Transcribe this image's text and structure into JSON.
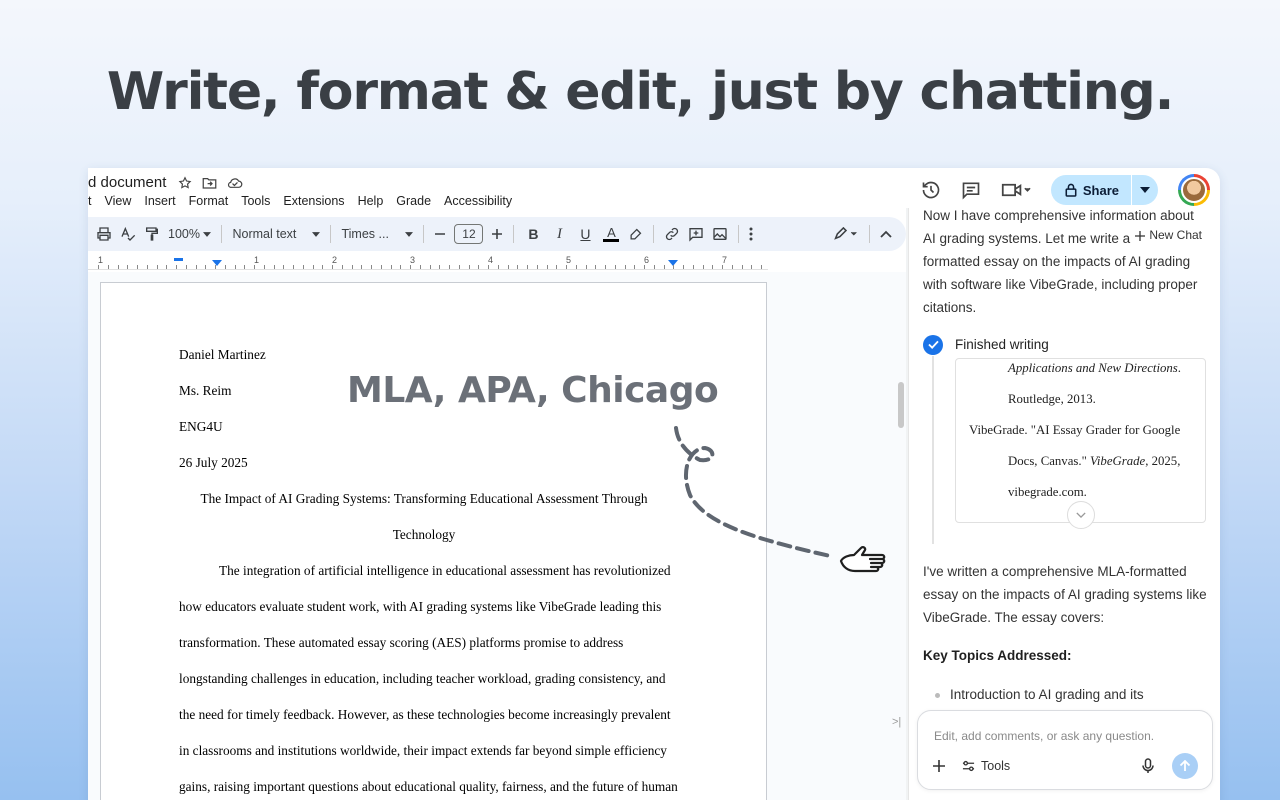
{
  "headline": "Write, format & edit, just by chatting.",
  "overlay_label": "MLA, APA, Chicago",
  "doc": {
    "title": "d document",
    "menu": [
      "t",
      "View",
      "Insert",
      "Format",
      "Tools",
      "Extensions",
      "Help",
      "Grade",
      "Accessibility"
    ],
    "share_label": "Share",
    "toolbar": {
      "zoom": "100%",
      "style": "Normal text",
      "font": "Times ...",
      "font_size": "12"
    },
    "ruler_numbers": [
      "1",
      "1",
      "2",
      "3",
      "4",
      "5",
      "6",
      "7"
    ],
    "lines": [
      "Daniel Martinez",
      "Ms. Reim",
      "ENG4U",
      "26 July 2025",
      "The Impact of AI Grading Systems: Transforming Educational Assessment Through",
      "Technology",
      "The integration of artificial intelligence in educational assessment has revolutionized",
      "how educators evaluate student work, with AI grading systems like VibeGrade leading this",
      "transformation. These automated essay scoring (AES) platforms promise to address",
      "longstanding challenges in education, including teacher workload, grading consistency, and",
      "the need for timely feedback. However, as these technologies become increasingly prevalent",
      "in classrooms and institutions worldwide, their impact extends far beyond simple efficiency",
      "gains, raising important questions about educational quality, fairness, and the future of human"
    ]
  },
  "chat": {
    "new_chat": "New Chat",
    "intro": "Now I have comprehensive information about AI grading systems. Let me write an MLA-formatted essay on the impacts of AI grading with software like VibeGrade, including proper citations.",
    "finished": "Finished writing",
    "preview": {
      "line1_italic": "Applications and New Directions",
      "line1_tail": ".",
      "line2": "Routledge, 2013.",
      "line3": "VibeGrade. \"AI Essay Grader for Google",
      "line4_pre": "Docs, Canvas.\" ",
      "line4_italic": "VibeGrade",
      "line4_tail": ", 2025,",
      "line5": "vibegrade.com."
    },
    "summary": "I've written a comprehensive MLA-formatted essay on the impacts of AI grading systems like VibeGrade. The essay covers:",
    "key_topics": "Key Topics Addressed:",
    "bullet1": "Introduction to AI grading and its",
    "composer_placeholder": "Edit, add comments, or ask any question.",
    "tools_label": "Tools"
  }
}
